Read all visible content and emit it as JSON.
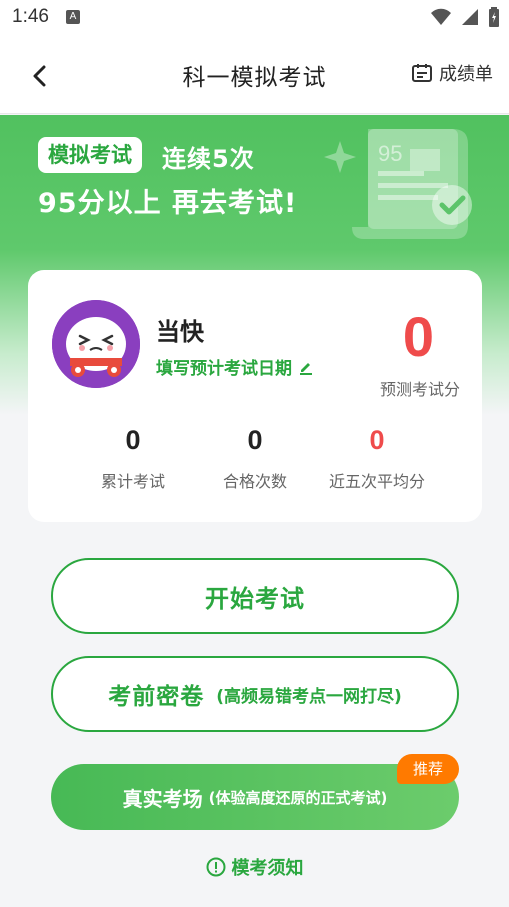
{
  "status_bar": {
    "time": "1:46",
    "notification_letter": "A",
    "icons": [
      "wifi-icon",
      "signal-icon",
      "battery-icon"
    ]
  },
  "nav": {
    "title": "科一模拟考试",
    "report_label": "成绩单",
    "back_icon": "chevron-left-icon",
    "report_icon": "report-card-icon"
  },
  "banner": {
    "tag": "模拟考试",
    "line1": "连续5次",
    "line2": "95分以上 再去考试!",
    "illustration_score": "95"
  },
  "profile": {
    "name": "当快",
    "exam_date_link": "填写预计考试日期",
    "predicted_score": "0",
    "predicted_label": "预测考试分"
  },
  "stats": [
    {
      "value": "0",
      "label": "累计考试"
    },
    {
      "value": "0",
      "label": "合格次数"
    },
    {
      "value": "0",
      "label": "近五次平均分"
    }
  ],
  "actions": {
    "start_label": "开始考试",
    "secret_label": "考前密卷",
    "secret_sub": "(高频易错考点一网打尽)",
    "real_label": "真实考场",
    "real_sub": "(体验高度还原的正式考试)",
    "recommend_badge": "推荐",
    "notice_label": "模考须知"
  },
  "colors": {
    "brand_green": "#2aa73f",
    "banner_green": "#51c15f",
    "score_red": "#ef4b4b",
    "badge_orange": "#ff7a00"
  }
}
